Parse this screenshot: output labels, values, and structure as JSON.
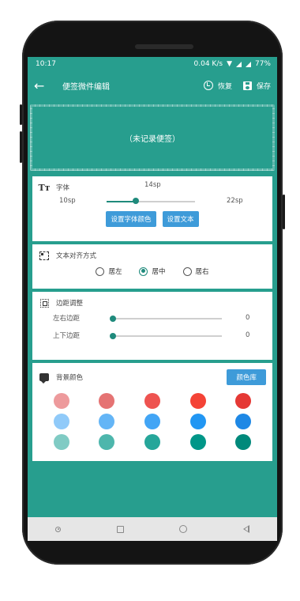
{
  "status_bar": {
    "time": "10:17",
    "network_speed": "0.04 K/s",
    "battery": "77%"
  },
  "toolbar": {
    "title": "便签微件编辑",
    "restore_label": "恢复",
    "save_label": "保存"
  },
  "preview": {
    "text": "（未记录便签）"
  },
  "font_card": {
    "label": "字体",
    "current_value": "14sp",
    "min_label": "10sp",
    "max_label": "22sp",
    "value_sp": 14,
    "min_sp": 10,
    "max_sp": 22,
    "color_button": "设置字体颜色",
    "text_button": "设置文本"
  },
  "align_card": {
    "label": "文本对齐方式",
    "options": [
      "居左",
      "居中",
      "居右"
    ],
    "selected": "居中"
  },
  "margin_card": {
    "label": "边距调整",
    "rows": [
      {
        "label": "左右边距",
        "value": "0"
      },
      {
        "label": "上下边距",
        "value": "0"
      }
    ]
  },
  "bg_card": {
    "label": "背景颜色",
    "library_button": "颜色库",
    "swatches": [
      [
        "#ed9a9c",
        "#e57373",
        "#ee5350",
        "#f44336",
        "#e53935"
      ],
      [
        "#90caf9",
        "#64b5f6",
        "#42a5f5",
        "#2196f3",
        "#1e88e5"
      ],
      [
        "#80cbc4",
        "#4db6ac",
        "#26a69a",
        "#009688",
        "#00897b"
      ]
    ]
  },
  "colors": {
    "primary": "#279e8e",
    "accent": "#1f8a7c",
    "button_blue": "#3e9bd9"
  }
}
